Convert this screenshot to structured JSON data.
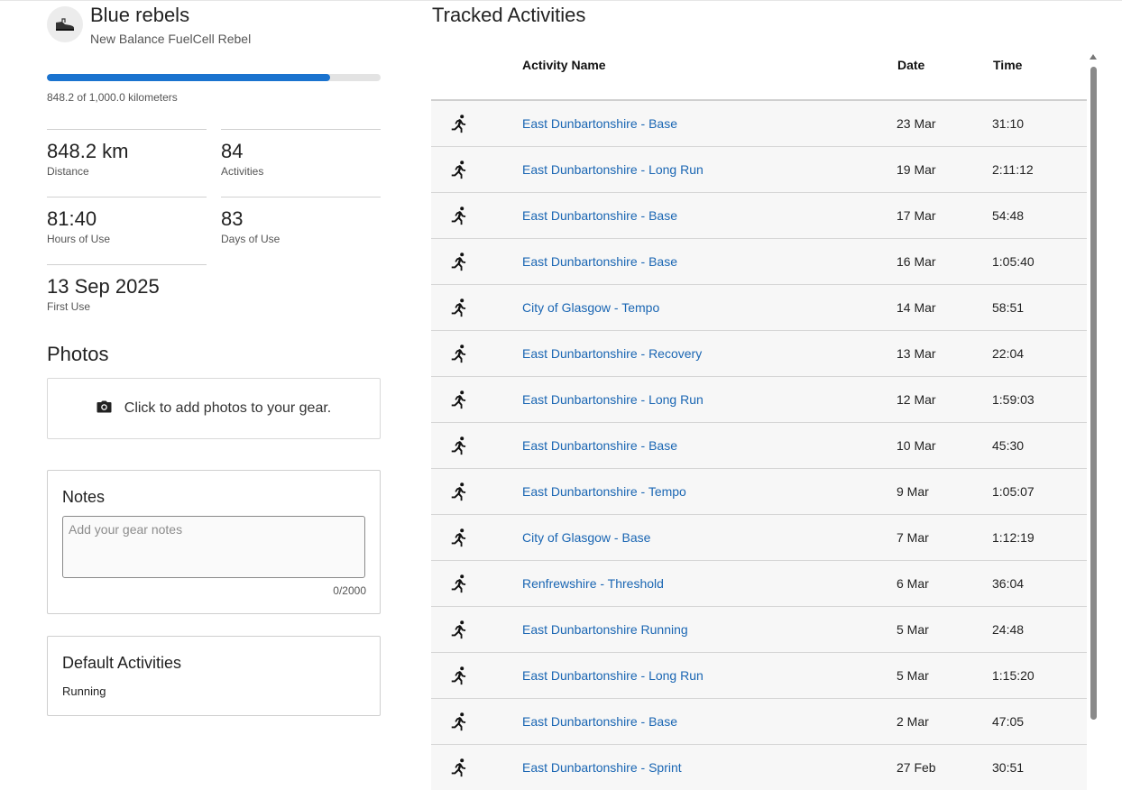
{
  "gear": {
    "icon": "shoe-icon",
    "name": "Blue rebels",
    "model": "New Balance FuelCell Rebel",
    "progress_fraction": 0.8482,
    "progress_label": "848.2 of 1,000.0 kilometers",
    "accent_color": "#1a73cf"
  },
  "stats": [
    {
      "value": "848.2 km",
      "label": "Distance"
    },
    {
      "value": "84",
      "label": "Activities"
    },
    {
      "value": "81:40",
      "label": "Hours of Use"
    },
    {
      "value": "83",
      "label": "Days of Use"
    },
    {
      "value": "13 Sep 2025",
      "label": "First Use"
    }
  ],
  "photos": {
    "heading": "Photos",
    "add_text": "Click to add photos to your gear.",
    "icon": "camera-icon"
  },
  "notes": {
    "title": "Notes",
    "placeholder": "Add your gear notes",
    "value": "",
    "counter": "0/2000"
  },
  "default_activities": {
    "title": "Default Activities",
    "items": [
      "Running"
    ]
  },
  "tracked": {
    "title": "Tracked Activities",
    "columns": {
      "name": "Activity Name",
      "date": "Date",
      "time": "Time"
    },
    "row_icon": "running-icon",
    "rows": [
      {
        "name": "East Dunbartonshire - Base",
        "date": "23 Mar",
        "time": "31:10"
      },
      {
        "name": "East Dunbartonshire - Long Run",
        "date": "19 Mar",
        "time": "2:11:12"
      },
      {
        "name": "East Dunbartonshire - Base",
        "date": "17 Mar",
        "time": "54:48"
      },
      {
        "name": "East Dunbartonshire - Base",
        "date": "16 Mar",
        "time": "1:05:40"
      },
      {
        "name": "City of Glasgow - Tempo",
        "date": "14 Mar",
        "time": "58:51"
      },
      {
        "name": "East Dunbartonshire - Recovery",
        "date": "13 Mar",
        "time": "22:04"
      },
      {
        "name": "East Dunbartonshire - Long Run",
        "date": "12 Mar",
        "time": "1:59:03"
      },
      {
        "name": "East Dunbartonshire - Base",
        "date": "10 Mar",
        "time": "45:30"
      },
      {
        "name": "East Dunbartonshire - Tempo",
        "date": "9 Mar",
        "time": "1:05:07"
      },
      {
        "name": "City of Glasgow - Base",
        "date": "7 Mar",
        "time": "1:12:19"
      },
      {
        "name": "Renfrewshire - Threshold",
        "date": "6 Mar",
        "time": "36:04"
      },
      {
        "name": "East Dunbartonshire Running",
        "date": "5 Mar",
        "time": "24:48"
      },
      {
        "name": "East Dunbartonshire - Long Run",
        "date": "5 Mar",
        "time": "1:15:20"
      },
      {
        "name": "East Dunbartonshire - Base",
        "date": "2 Mar",
        "time": "47:05"
      },
      {
        "name": "East Dunbartonshire - Sprint",
        "date": "27 Feb",
        "time": "30:51"
      }
    ]
  }
}
